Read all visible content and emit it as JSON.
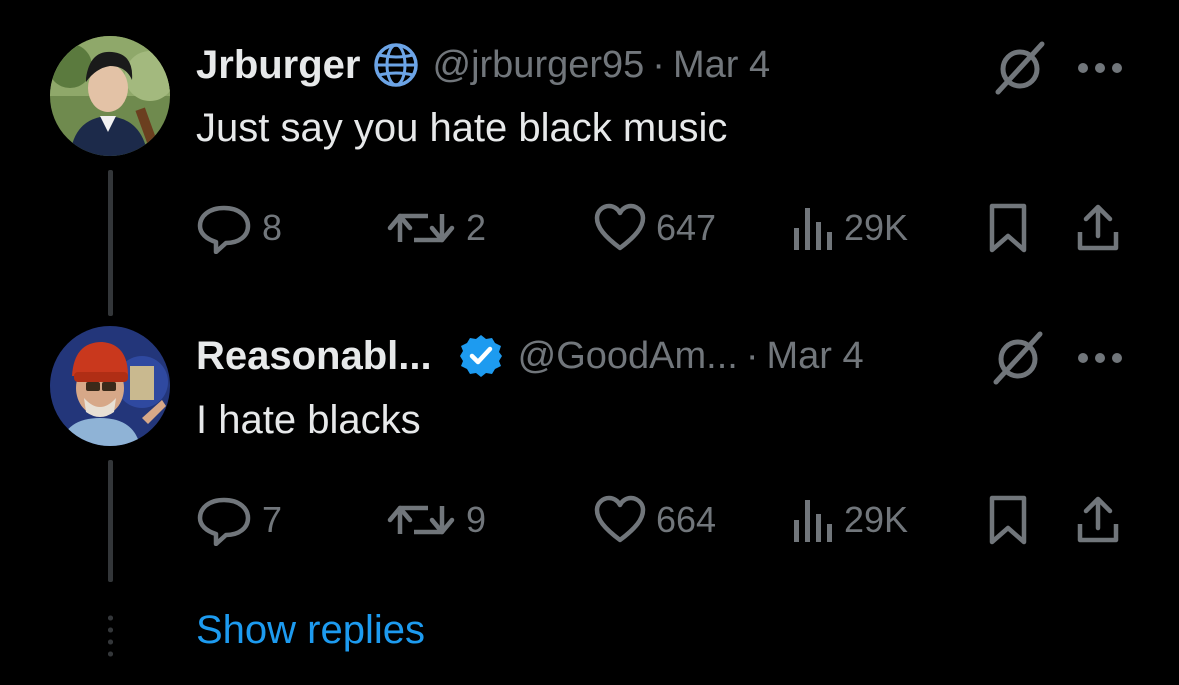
{
  "tweets": [
    {
      "name": "Jrburger",
      "handle": "@jrburger95",
      "separator": "·",
      "date": "Mar 4",
      "text": "Just say you hate black music",
      "badge": "globe-icon",
      "avatar": "avatar-photo",
      "replies": "8",
      "reposts": "2",
      "likes": "647",
      "views": "29K"
    },
    {
      "name": "Reasonabl...",
      "handle": "@GoodAm...",
      "separator": "·",
      "date": "Mar 4",
      "text": "I hate blacks",
      "badge": "verified-badge-icon",
      "avatar": "avatar-photo",
      "replies": "7",
      "reposts": "9",
      "likes": "664",
      "views": "29K"
    }
  ],
  "show_replies": "Show replies",
  "colors": {
    "background": "#000000",
    "text": "#e7e9ea",
    "muted": "#71767b",
    "accent": "#1d9bf0",
    "thread": "#333639"
  }
}
